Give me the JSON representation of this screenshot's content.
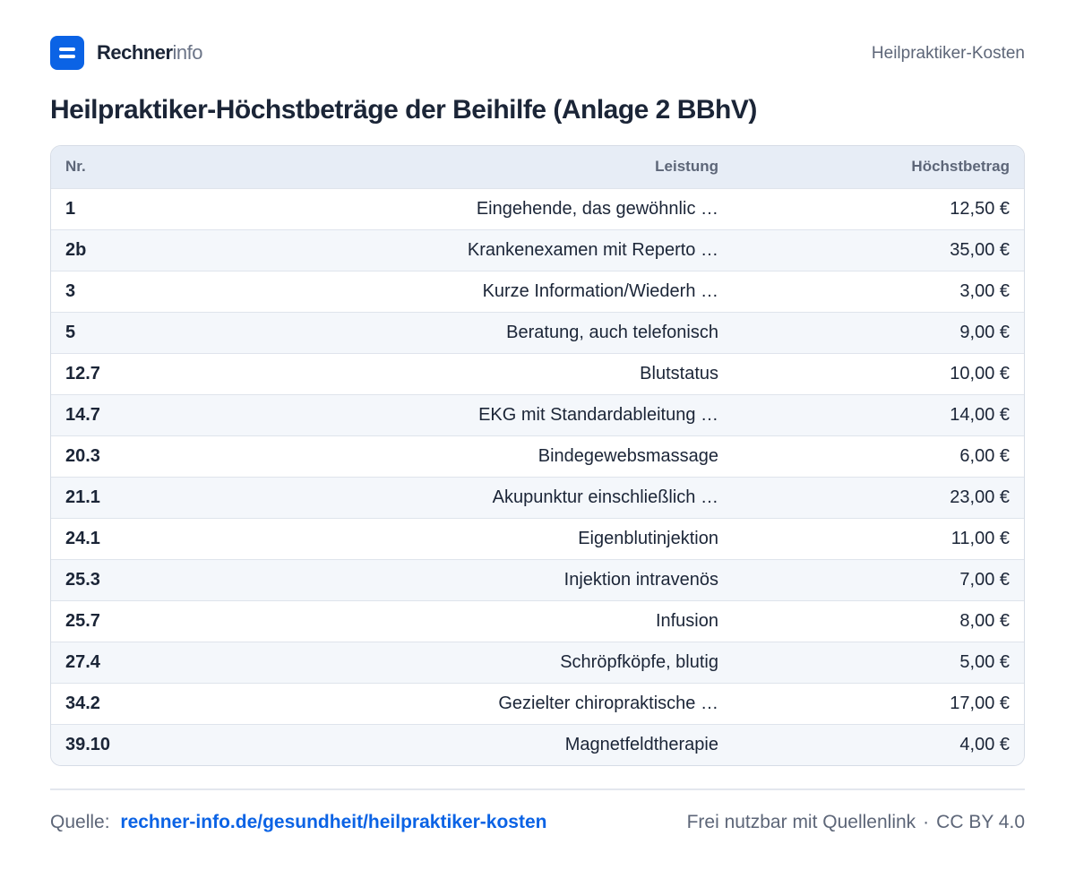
{
  "brand": {
    "name_strong": "Rechner",
    "name_light": "info"
  },
  "header": {
    "section": "Heilpraktiker-Kosten"
  },
  "title": "Heilpraktiker-Höchstbeträge der Beihilfe (Anlage 2 BBhV)",
  "table": {
    "columns": [
      "Nr.",
      "Leistung",
      "Höchstbetrag"
    ],
    "rows": [
      {
        "nr": "1",
        "leistung": "Eingehende, das gewöhnlic …",
        "betrag": "12,50 €"
      },
      {
        "nr": "2b",
        "leistung": "Krankenexamen mit Reperto …",
        "betrag": "35,00 €"
      },
      {
        "nr": "3",
        "leistung": "Kurze Information/Wiederh …",
        "betrag": "3,00 €"
      },
      {
        "nr": "5",
        "leistung": "Beratung, auch telefonisch",
        "betrag": "9,00 €"
      },
      {
        "nr": "12.7",
        "leistung": "Blutstatus",
        "betrag": "10,00 €"
      },
      {
        "nr": "14.7",
        "leistung": "EKG mit Standardableitung …",
        "betrag": "14,00 €"
      },
      {
        "nr": "20.3",
        "leistung": "Bindegewebsmassage",
        "betrag": "6,00 €"
      },
      {
        "nr": "21.1",
        "leistung": "Akupunktur einschließlich …",
        "betrag": "23,00 €"
      },
      {
        "nr": "24.1",
        "leistung": "Eigenblutinjektion",
        "betrag": "11,00 €"
      },
      {
        "nr": "25.3",
        "leistung": "Injektion intravenös",
        "betrag": "7,00 €"
      },
      {
        "nr": "25.7",
        "leistung": "Infusion",
        "betrag": "8,00 €"
      },
      {
        "nr": "27.4",
        "leistung": "Schröpfköpfe, blutig",
        "betrag": "5,00 €"
      },
      {
        "nr": "34.2",
        "leistung": "Gezielter chiropraktische …",
        "betrag": "17,00 €"
      },
      {
        "nr": "39.10",
        "leistung": "Magnetfeldtherapie",
        "betrag": "4,00 €"
      }
    ]
  },
  "footer": {
    "source_label": "Quelle:",
    "source_link": "rechner-info.de/gesundheit/heilpraktiker-kosten",
    "license_text": "Frei nutzbar mit Quellenlink",
    "separator": "·",
    "license": "CC BY 4.0"
  },
  "colors": {
    "accent": "#0b63e5",
    "text": "#1b2537",
    "muted": "#5d6678",
    "header_bg": "#e7edf6",
    "row_alt": "#f4f7fb"
  }
}
